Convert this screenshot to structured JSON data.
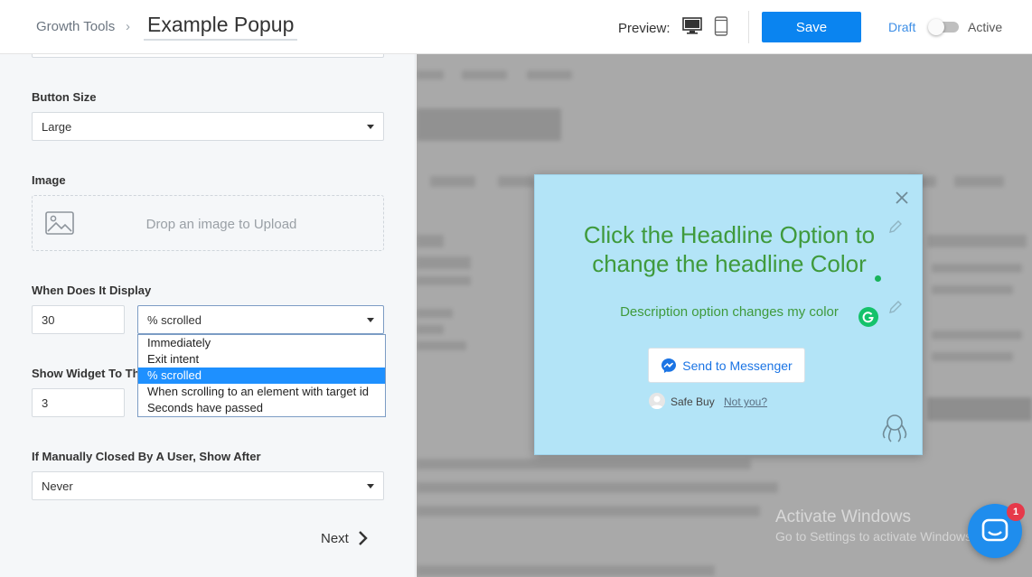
{
  "header": {
    "breadcrumb_root": "Growth Tools",
    "breadcrumb_sep": "›",
    "title": "Example Popup",
    "preview_label": "Preview:",
    "save_label": "Save",
    "draft_label": "Draft",
    "active_label": "Active",
    "accent_color": "#0a84f0"
  },
  "form": {
    "button_size": {
      "label": "Button Size",
      "value": "Large"
    },
    "image": {
      "label": "Image",
      "dropzone_text": "Drop an image to Upload"
    },
    "when_display": {
      "label": "When Does It Display",
      "amount": "30",
      "trigger": "% scrolled",
      "options": [
        "Immediately",
        "Exit intent",
        "% scrolled",
        "When scrolling to an element with target id",
        "Seconds have passed"
      ]
    },
    "show_widget": {
      "label": "Show Widget To Th",
      "value": "3"
    },
    "manually_closed": {
      "label": "If Manually Closed By A User, Show After",
      "value": "Never"
    },
    "next_label": "Next"
  },
  "popup": {
    "headline": "Click the Headline Option to change the headline Color",
    "description": "Description option changes my color",
    "messenger_button": "Send to Messenger",
    "safe_buy": "Safe Buy",
    "not_you": "Not you?",
    "background": "#b3e4f7",
    "text_color": "#3f9a3c"
  },
  "watermark": {
    "title": "Activate Windows",
    "subtitle": "Go to Settings to activate Windows."
  },
  "chat": {
    "badge": "1"
  }
}
